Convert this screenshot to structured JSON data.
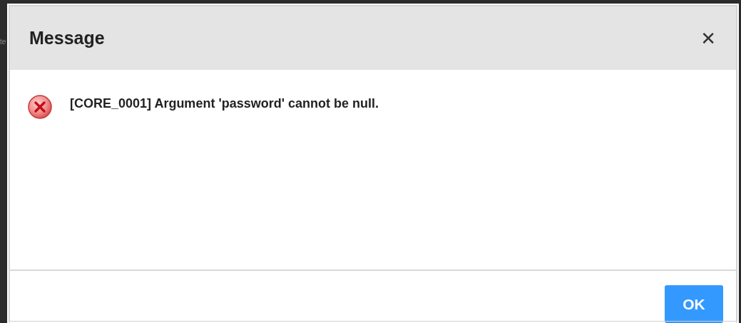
{
  "background": {
    "fragment": "te"
  },
  "dialog": {
    "title": "Message",
    "close_label": "✕",
    "message": {
      "kind": "error",
      "text": "[CORE_0001] Argument 'password' cannot be null."
    },
    "buttons": [
      {
        "label": "OK",
        "kind": "primary"
      }
    ]
  }
}
